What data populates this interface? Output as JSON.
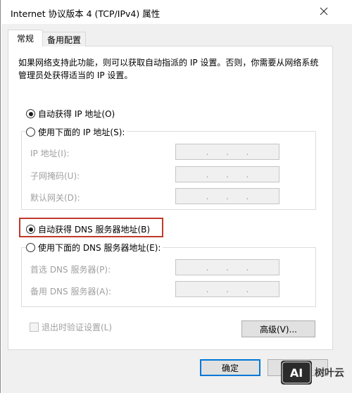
{
  "window": {
    "title": "Internet 协议版本 4 (TCP/IPv4) 属性",
    "close_glyph": "✕"
  },
  "tabs": [
    {
      "label": "常规",
      "active": true
    },
    {
      "label": "备用配置",
      "active": false
    }
  ],
  "description": "如果网络支持此功能，则可以获取自动指派的 IP 设置。否则，你需要从网络系统管理员处获得适当的 IP 设置。",
  "ip_section": {
    "auto_label": "自动获得 IP 地址(O)",
    "auto_checked": true,
    "manual_label": "使用下面的 IP 地址(S):",
    "manual_checked": false,
    "fields": [
      {
        "label": "IP 地址(I):",
        "value": ""
      },
      {
        "label": "子网掩码(U):",
        "value": ""
      },
      {
        "label": "默认网关(D):",
        "value": ""
      }
    ]
  },
  "dns_section": {
    "auto_label": "自动获得 DNS 服务器地址(B)",
    "auto_checked": true,
    "manual_label": "使用下面的 DNS 服务器地址(E):",
    "manual_checked": false,
    "fields": [
      {
        "label": "首选 DNS 服务器(P):",
        "value": ""
      },
      {
        "label": "备用 DNS 服务器(A):",
        "value": ""
      }
    ]
  },
  "validate_label": "退出时验证设置(L)",
  "validate_checked": false,
  "buttons": {
    "advanced": "高级(V)...",
    "ok": "确定",
    "cancel": "取消"
  },
  "ip_dot": ".",
  "colors": {
    "highlight_border": "#c0392b",
    "ok_border": "#0078d7"
  },
  "watermark": {
    "logo_text": "AI",
    "text": "树叶云"
  }
}
